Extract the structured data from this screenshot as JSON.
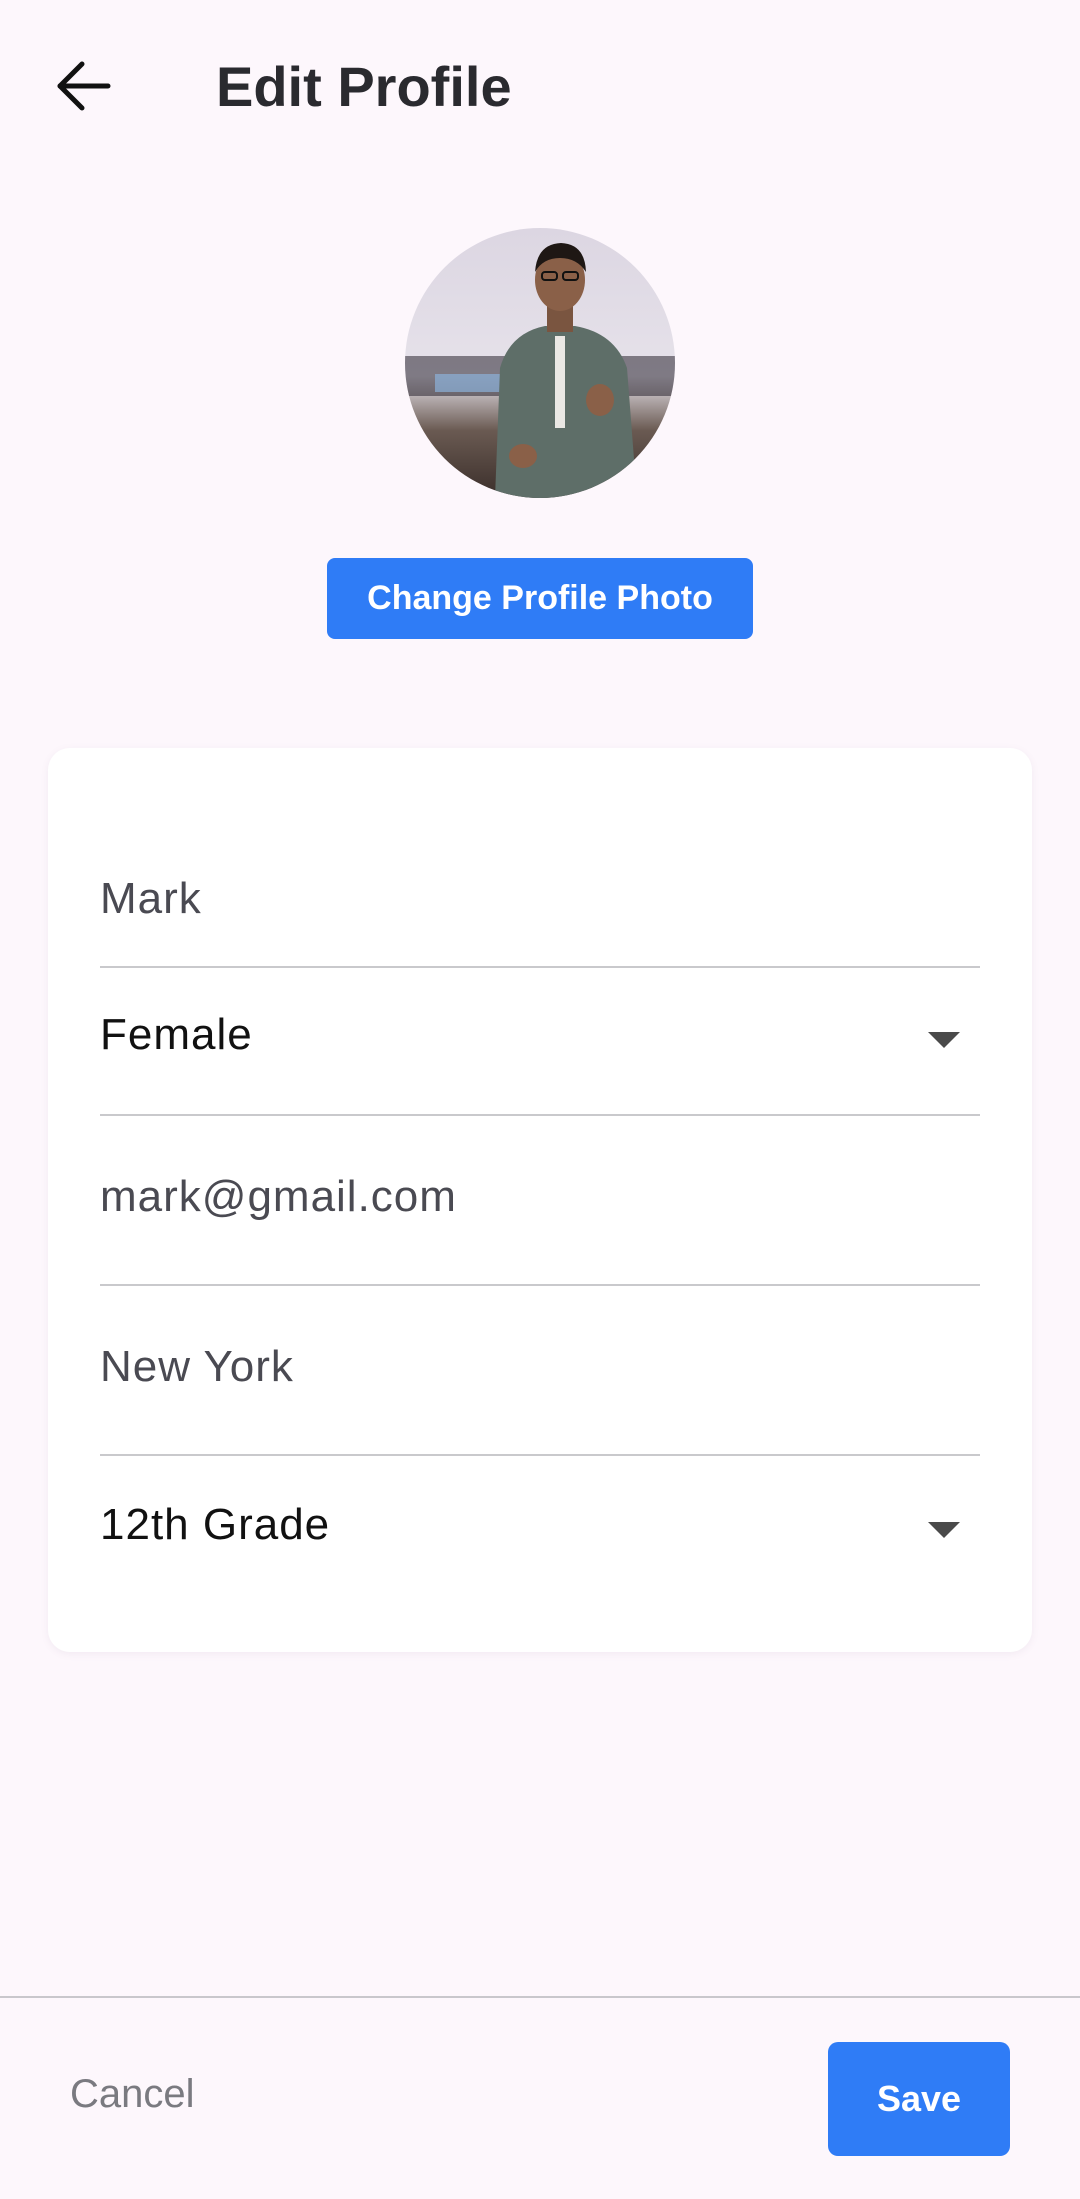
{
  "header": {
    "title": "Edit Profile",
    "back_icon": "arrow-left-icon"
  },
  "profile": {
    "avatar_icon": "profile-photo",
    "change_photo_label": "Change Profile Photo"
  },
  "form": {
    "name": "Mark",
    "gender": "Female",
    "email": "mark@gmail.com",
    "city": "New York",
    "grade": "12th Grade"
  },
  "footer": {
    "cancel_label": "Cancel",
    "save_label": "Save"
  },
  "colors": {
    "accent": "#2f7cf6",
    "background": "#fdf7fc"
  }
}
